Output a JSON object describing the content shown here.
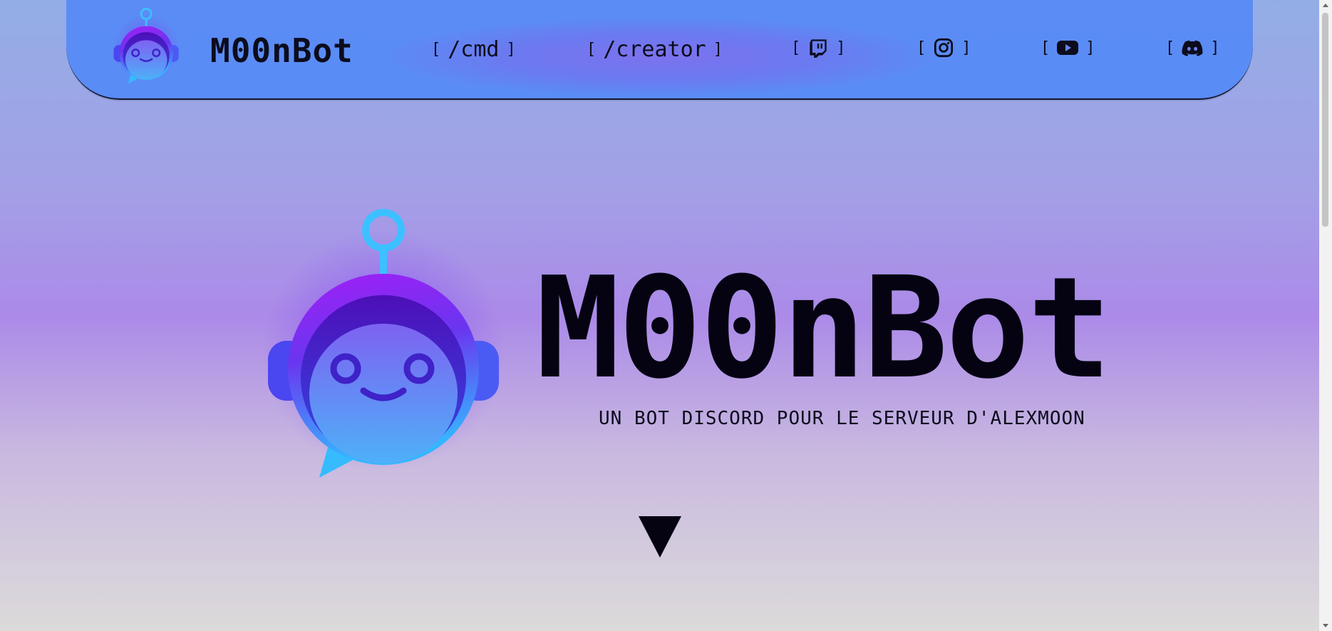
{
  "nav": {
    "brand": "M00nBot",
    "links": {
      "cmd": {
        "open": "[",
        "label": "/cmd",
        "close": "]"
      },
      "creator": {
        "open": "[",
        "label": "/creator",
        "close": "]"
      },
      "twitch": {
        "open": "[",
        "icon": "twitch-icon",
        "close": "]"
      },
      "instagram": {
        "open": "[",
        "icon": "instagram-icon",
        "close": "]"
      },
      "youtube": {
        "open": "[",
        "icon": "youtube-icon",
        "close": "]"
      },
      "discord": {
        "open": "[",
        "icon": "discord-icon",
        "close": "]"
      }
    }
  },
  "hero": {
    "title": "M00nBot",
    "subtitle": "UN BOT DISCORD POUR LE SERVEUR D'ALEXMOON",
    "scroll_icon": "down-triangle-icon"
  },
  "colors": {
    "nav_bg": "#5a8ef4",
    "text": "#050312",
    "bot_purple": "#9b1ff6",
    "bot_blue": "#33b6ff"
  }
}
